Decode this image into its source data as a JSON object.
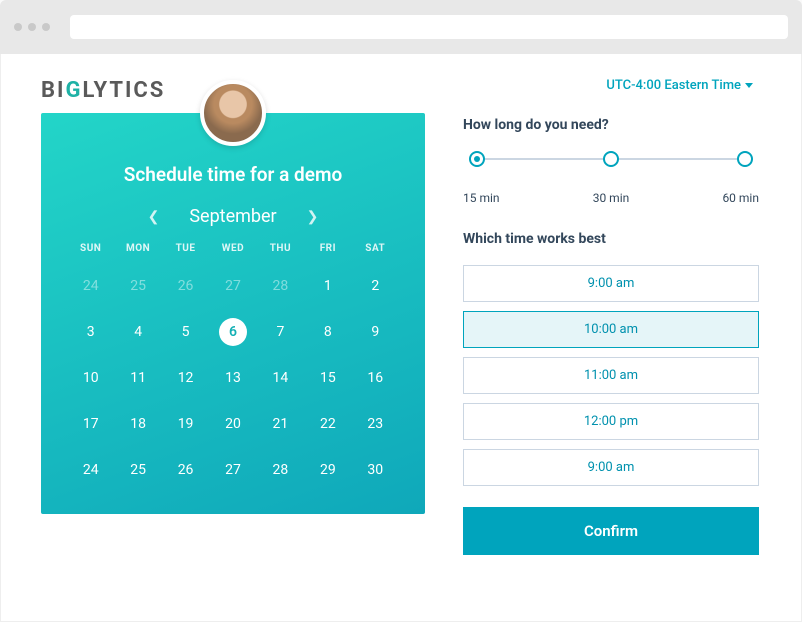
{
  "logo": {
    "pre": "BI",
    "accent": "G",
    "post": "LYTICS"
  },
  "timezone": "UTC-4:00 Eastern Time",
  "schedule_title": "Schedule time for a demo",
  "month": "September",
  "dow": [
    "SUN",
    "MON",
    "TUE",
    "WED",
    "THU",
    "FRI",
    "SAT"
  ],
  "weeks": [
    [
      {
        "n": "24",
        "dim": true
      },
      {
        "n": "25",
        "dim": true
      },
      {
        "n": "26",
        "dim": true
      },
      {
        "n": "27",
        "dim": true
      },
      {
        "n": "28",
        "dim": true
      },
      {
        "n": "1"
      },
      {
        "n": "2"
      }
    ],
    [
      {
        "n": "3"
      },
      {
        "n": "4"
      },
      {
        "n": "5"
      },
      {
        "n": "6",
        "sel": true
      },
      {
        "n": "7"
      },
      {
        "n": "8"
      },
      {
        "n": "9"
      }
    ],
    [
      {
        "n": "10"
      },
      {
        "n": "11"
      },
      {
        "n": "12"
      },
      {
        "n": "13"
      },
      {
        "n": "14"
      },
      {
        "n": "15"
      },
      {
        "n": "16"
      }
    ],
    [
      {
        "n": "17"
      },
      {
        "n": "18"
      },
      {
        "n": "19"
      },
      {
        "n": "20"
      },
      {
        "n": "21"
      },
      {
        "n": "22"
      },
      {
        "n": "23"
      }
    ],
    [
      {
        "n": "24"
      },
      {
        "n": "25"
      },
      {
        "n": "26"
      },
      {
        "n": "27"
      },
      {
        "n": "28"
      },
      {
        "n": "29"
      },
      {
        "n": "30"
      }
    ]
  ],
  "duration_q": "How long do you need?",
  "durations": [
    "15 min",
    "30 min",
    "60 min"
  ],
  "duration_selected_index": 0,
  "time_q": "Which time works best",
  "times": [
    {
      "label": "9:00 am"
    },
    {
      "label": "10:00 am",
      "selected": true
    },
    {
      "label": "11:00 am"
    },
    {
      "label": "12:00 pm"
    },
    {
      "label": "9:00 am"
    }
  ],
  "confirm_label": "Confirm"
}
